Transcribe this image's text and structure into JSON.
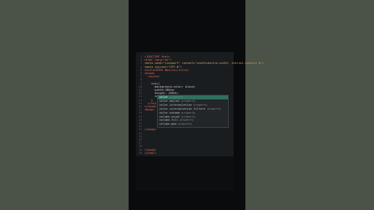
{
  "editor": {
    "lines": [
      {
        "n": "1",
        "segments": [
          {
            "t": "<!DOCTYPE html>",
            "c": "tag"
          }
        ]
      },
      {
        "n": "2",
        "segments": [
          {
            "t": "<html lang=\"en\">",
            "c": "tag"
          }
        ]
      },
      {
        "n": "3",
        "segments": [
          {
            "t": "<meta name=\"viewport\" content=\"width=device-width, initial-scale=1.0\">",
            "c": "attr"
          }
        ]
      },
      {
        "n": "4",
        "segments": [
          {
            "t": "<meta charset=\"UTF-8\">",
            "c": "attr"
          }
        ]
      },
      {
        "n": "5",
        "segments": [
          {
            "t": "<title>HTML Basics</title>",
            "c": "tag"
          }
        ]
      },
      {
        "n": "6",
        "segments": [
          {
            "t": "<head>",
            "c": "tag"
          }
        ]
      },
      {
        "n": "7",
        "segments": [
          {
            "t": "  <style>",
            "c": "tag"
          }
        ]
      },
      {
        "n": "8",
        "segments": [
          {
            "t": "",
            "c": "prop"
          }
        ]
      },
      {
        "n": "9",
        "segments": [
          {
            "t": "    body{",
            "c": "kw"
          }
        ]
      },
      {
        "n": "10",
        "segments": [
          {
            "t": "      background-color: black;",
            "c": "prop"
          }
        ]
      },
      {
        "n": "11",
        "segments": [
          {
            "t": "      width:100vw;",
            "c": "prop"
          }
        ]
      },
      {
        "n": "12",
        "segments": [
          {
            "t": "      height: 100vh;",
            "c": "prop"
          }
        ]
      },
      {
        "n": "13",
        "segments": [
          {
            "t": "      co",
            "c": "prop"
          }
        ]
      },
      {
        "n": "14",
        "segments": [
          {
            "t": "    }",
            "c": "kw"
          }
        ]
      },
      {
        "n": "15",
        "segments": [
          {
            "t": "  </sty",
            "c": "tag"
          }
        ]
      },
      {
        "n": "16",
        "segments": [
          {
            "t": "</head>",
            "c": "tag"
          }
        ]
      },
      {
        "n": "17",
        "segments": [
          {
            "t": "<body>",
            "c": "tag"
          }
        ]
      },
      {
        "n": "18",
        "segments": [
          {
            "t": "",
            "c": "prop"
          }
        ]
      },
      {
        "n": "19",
        "segments": [
          {
            "t": "",
            "c": "prop"
          }
        ]
      },
      {
        "n": "20",
        "segments": [
          {
            "t": "",
            "c": "prop"
          }
        ]
      },
      {
        "n": "21",
        "segments": [
          {
            "t": "",
            "c": "prop"
          }
        ]
      },
      {
        "n": "22",
        "segments": [
          {
            "t": "",
            "c": "prop"
          }
        ]
      },
      {
        "n": "23",
        "segments": [
          {
            "t": "</body>",
            "c": "tag"
          }
        ]
      },
      {
        "n": "24",
        "segments": [
          {
            "t": "",
            "c": "prop"
          }
        ]
      },
      {
        "n": "25",
        "segments": [
          {
            "t": "",
            "c": "prop"
          }
        ]
      },
      {
        "n": "26",
        "segments": [
          {
            "t": "",
            "c": "prop"
          }
        ]
      },
      {
        "n": "27",
        "segments": [
          {
            "t": "",
            "c": "prop"
          }
        ]
      },
      {
        "n": "28",
        "segments": [
          {
            "t": "",
            "c": "prop"
          }
        ]
      },
      {
        "n": "29",
        "segments": [
          {
            "t": "</body>",
            "c": "tag"
          }
        ]
      },
      {
        "n": "30",
        "segments": [
          {
            "t": "</html>",
            "c": "tag"
          }
        ]
      }
    ]
  },
  "autocomplete": {
    "items": [
      {
        "label": "color",
        "type": "property",
        "selected": true
      },
      {
        "label": "color-adjust",
        "type": "property",
        "selected": false
      },
      {
        "label": "color-interpolation",
        "type": "property",
        "selected": false
      },
      {
        "label": "color-interpolation-filters",
        "type": "property",
        "selected": false
      },
      {
        "label": "color-scheme",
        "type": "property",
        "selected": false
      },
      {
        "label": "column-count",
        "type": "property",
        "selected": false
      },
      {
        "label": "column-fill",
        "type": "property",
        "selected": false
      },
      {
        "label": "column-gap",
        "type": "property",
        "selected": false
      }
    ]
  },
  "colors": {
    "background": "#4a5146",
    "editor_bg": "#1a1d20",
    "selection": "#2f6f5e"
  }
}
